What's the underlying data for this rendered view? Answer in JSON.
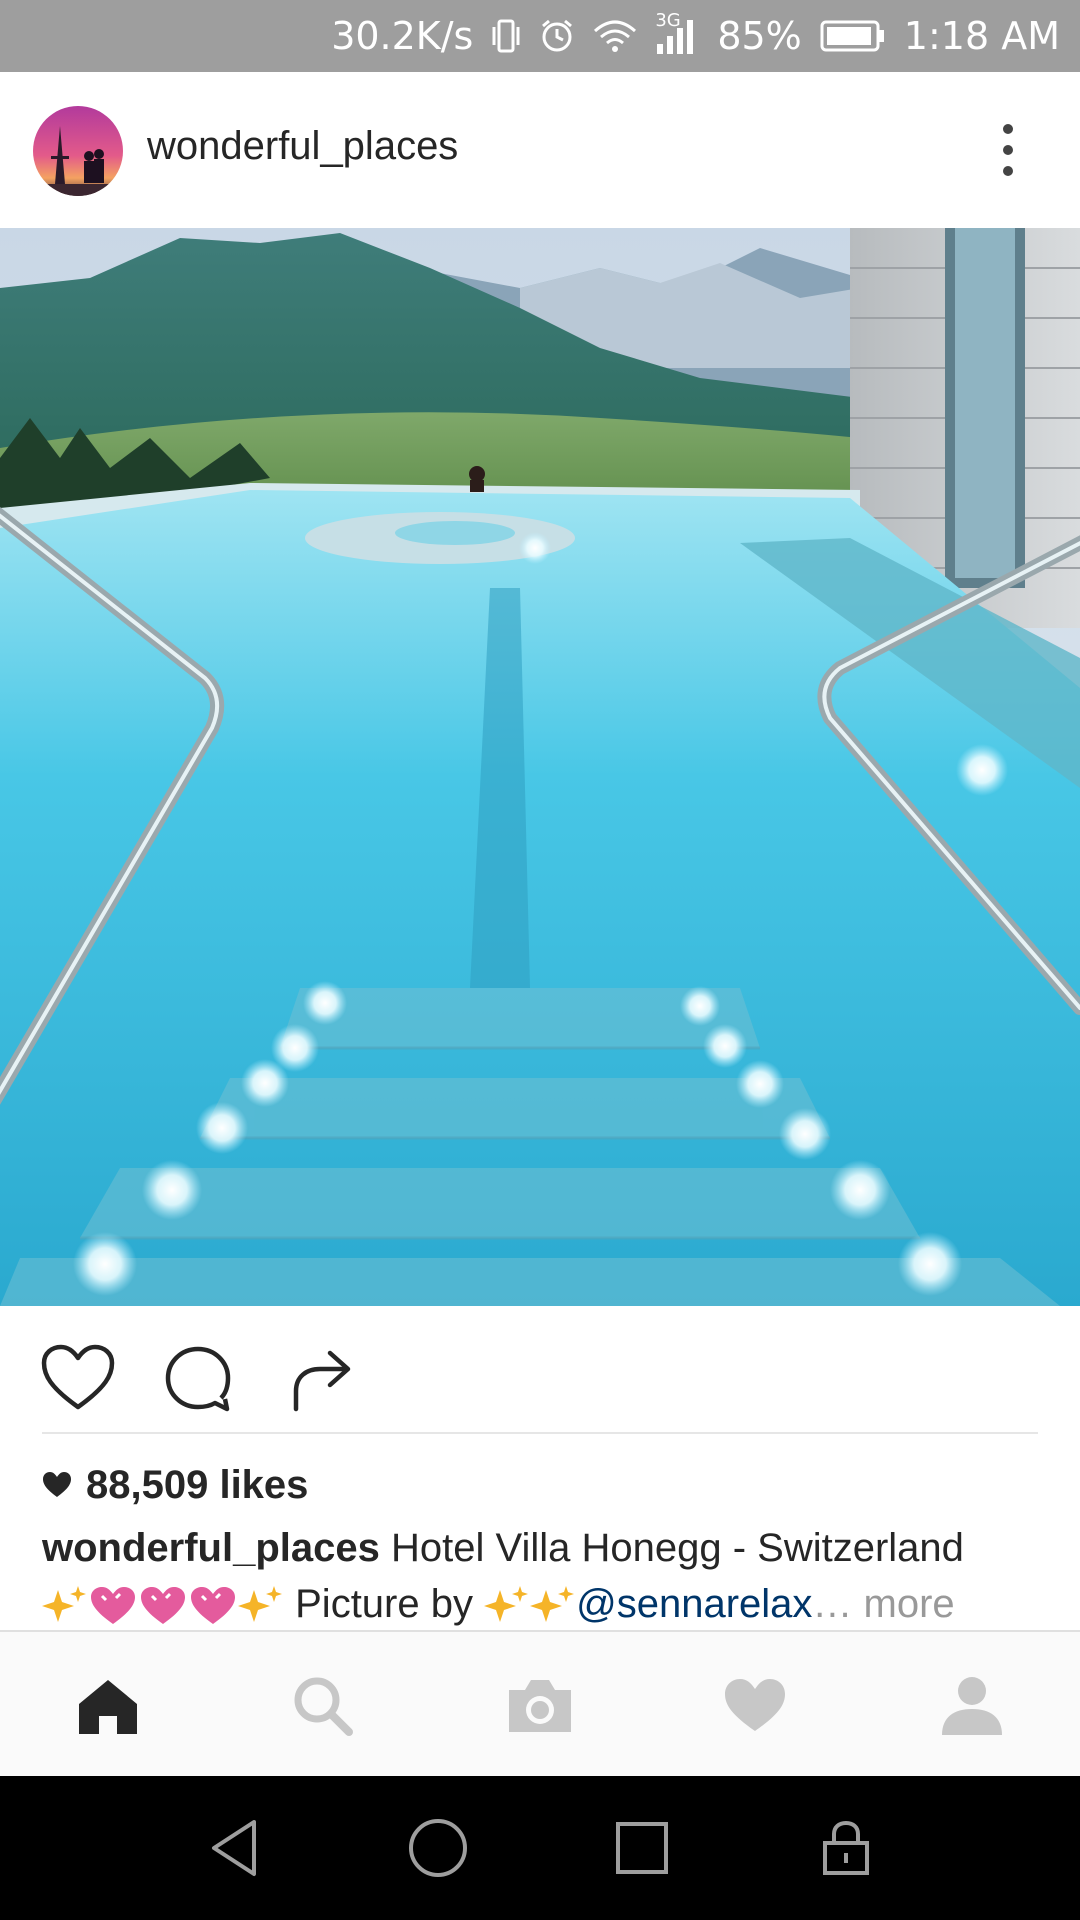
{
  "status_bar": {
    "network_speed": "30.2K/s",
    "network_type": "3G",
    "battery": "85%",
    "time": "1:18 AM",
    "icons": [
      "vibrate-icon",
      "alarm-icon",
      "wifi-icon",
      "signal-icon",
      "battery-icon"
    ]
  },
  "post": {
    "username": "wonderful_places",
    "photo_alt_icon": "pool-photo",
    "likes": "88,509 likes",
    "caption": {
      "username": "wonderful_places",
      "text": "Hotel Villa Honegg - Switzerland",
      "picture_by": "Picture by",
      "mention": "@sennarelax",
      "ellipsis": "…",
      "more": "more"
    }
  },
  "actions": [
    "like-icon",
    "comment-icon",
    "share-icon"
  ],
  "bottom_nav": [
    "home-icon",
    "search-icon",
    "camera-icon",
    "activity-heart-icon",
    "profile-icon"
  ],
  "system_nav": [
    "back-icon",
    "home-circle-icon",
    "recents-icon",
    "lock-icon"
  ],
  "colors": {
    "status_bar": "#9e9e9e",
    "mention": "#003569",
    "muted": "#999999",
    "pool": "#3fc6e6"
  }
}
